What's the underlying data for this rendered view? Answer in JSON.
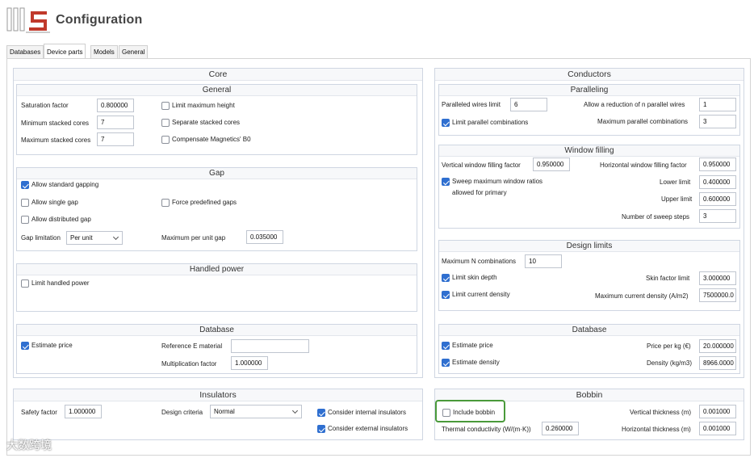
{
  "app": {
    "title": "Configuration",
    "logo_text": "WS"
  },
  "tabs": [
    "Databases",
    "Device parts",
    "Models",
    "General"
  ],
  "core": {
    "title": "Core",
    "general": {
      "title": "General",
      "saturation_factor_label": "Saturation factor",
      "saturation_factor_value": "0.800000",
      "min_stacked_label": "Minimum stacked cores",
      "min_stacked_value": "7",
      "max_stacked_label": "Maximum stacked cores",
      "max_stacked_value": "7",
      "limit_max_height": "Limit maximum height",
      "separate_stacked": "Separate stacked cores",
      "compensate_b0": "Compensate Magnetics' B0"
    },
    "gap": {
      "title": "Gap",
      "allow_standard": "Allow standard gapping",
      "allow_single": "Allow single gap",
      "force_predefined": "Force predefined gaps",
      "allow_distributed": "Allow distributed gap",
      "gap_limitation_label": "Gap limitation",
      "gap_limitation_value": "Per unit",
      "max_per_unit_label": "Maximum per unit gap",
      "max_per_unit_value": "0.035000"
    },
    "handled_power": {
      "title": "Handled power",
      "limit_handled": "Limit handled power"
    },
    "database": {
      "title": "Database",
      "estimate_price": "Estimate price",
      "reference_e_label": "Reference E material",
      "reference_e_value": "",
      "multiplication_label": "Multiplication factor",
      "multiplication_value": "1.000000"
    }
  },
  "insulators": {
    "title": "Insulators",
    "safety_label": "Safety factor",
    "safety_value": "1.000000",
    "design_criteria_label": "Design criteria",
    "design_criteria_value": "Normal",
    "consider_internal": "Consider internal insulators",
    "consider_external": "Consider external insulators"
  },
  "conductors": {
    "title": "Conductors",
    "paralleling": {
      "title": "Paralleling",
      "paralleled_limit_label": "Paralleled wires limit",
      "paralleled_limit_value": "6",
      "allow_reduction_label": "Allow a reduction of n parallel wires",
      "allow_reduction_value": "1",
      "limit_parallel": "Limit parallel combinations",
      "max_parallel_label": "Maximum parallel combinations",
      "max_parallel_value": "3"
    },
    "window_filling": {
      "title": "Window filling",
      "vertical_label": "Vertical window filling factor",
      "vertical_value": "0.950000",
      "horizontal_label": "Horizontal window filling factor",
      "horizontal_value": "0.950000",
      "sweep_line1": "Sweep maximum window ratios",
      "sweep_line2": "allowed for primary",
      "lower_label": "Lower limit",
      "lower_value": "0.400000",
      "upper_label": "Upper limit",
      "upper_value": "0.600000",
      "steps_label": "Number of sweep steps",
      "steps_value": "3"
    },
    "design_limits": {
      "title": "Design limits",
      "max_n_label": "Maximum N combinations",
      "max_n_value": "10",
      "limit_skin": "Limit skin depth",
      "skin_factor_label": "Skin factor limit",
      "skin_factor_value": "3.000000",
      "limit_current": "Limit current density",
      "max_current_label": "Maximum current density (A/m2)",
      "max_current_value": "7500000.0"
    },
    "database": {
      "title": "Database",
      "estimate_price": "Estimate price",
      "price_label": "Price per kg (€)",
      "price_value": "20.000000",
      "estimate_density": "Estimate density",
      "density_label": "Density (kg/m3)",
      "density_value": "8966.0000"
    }
  },
  "bobbin": {
    "title": "Bobbin",
    "include_bobbin": "Include bobbin",
    "vertical_thickness_label": "Vertical thickness (m)",
    "vertical_thickness_value": "0.001000",
    "thermal_label": "Thermal conductivity (W/(m·K))",
    "thermal_value": "0.260000",
    "horizontal_thickness_label": "Horizontal thickness (m)",
    "horizontal_thickness_value": "0.001000"
  },
  "watermark": "大数跨境"
}
